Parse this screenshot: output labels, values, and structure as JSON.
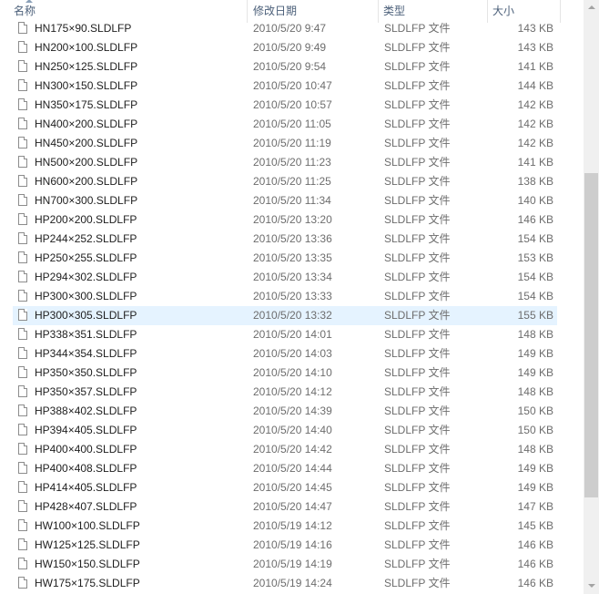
{
  "columns": {
    "name": "名称",
    "date": "修改日期",
    "type": "类型",
    "size": "大小"
  },
  "selected_index": 15,
  "files": [
    {
      "name": "HN175×90.SLDLFP",
      "date": "2010/5/20 9:47",
      "type": "SLDLFP 文件",
      "size": "143 KB"
    },
    {
      "name": "HN200×100.SLDLFP",
      "date": "2010/5/20 9:49",
      "type": "SLDLFP 文件",
      "size": "143 KB"
    },
    {
      "name": "HN250×125.SLDLFP",
      "date": "2010/5/20 9:54",
      "type": "SLDLFP 文件",
      "size": "141 KB"
    },
    {
      "name": "HN300×150.SLDLFP",
      "date": "2010/5/20 10:47",
      "type": "SLDLFP 文件",
      "size": "144 KB"
    },
    {
      "name": "HN350×175.SLDLFP",
      "date": "2010/5/20 10:57",
      "type": "SLDLFP 文件",
      "size": "142 KB"
    },
    {
      "name": "HN400×200.SLDLFP",
      "date": "2010/5/20 11:05",
      "type": "SLDLFP 文件",
      "size": "142 KB"
    },
    {
      "name": "HN450×200.SLDLFP",
      "date": "2010/5/20 11:19",
      "type": "SLDLFP 文件",
      "size": "142 KB"
    },
    {
      "name": "HN500×200.SLDLFP",
      "date": "2010/5/20 11:23",
      "type": "SLDLFP 文件",
      "size": "141 KB"
    },
    {
      "name": "HN600×200.SLDLFP",
      "date": "2010/5/20 11:25",
      "type": "SLDLFP 文件",
      "size": "138 KB"
    },
    {
      "name": "HN700×300.SLDLFP",
      "date": "2010/5/20 11:34",
      "type": "SLDLFP 文件",
      "size": "140 KB"
    },
    {
      "name": "HP200×200.SLDLFP",
      "date": "2010/5/20 13:20",
      "type": "SLDLFP 文件",
      "size": "146 KB"
    },
    {
      "name": "HP244×252.SLDLFP",
      "date": "2010/5/20 13:36",
      "type": "SLDLFP 文件",
      "size": "154 KB"
    },
    {
      "name": "HP250×255.SLDLFP",
      "date": "2010/5/20 13:35",
      "type": "SLDLFP 文件",
      "size": "153 KB"
    },
    {
      "name": "HP294×302.SLDLFP",
      "date": "2010/5/20 13:34",
      "type": "SLDLFP 文件",
      "size": "154 KB"
    },
    {
      "name": "HP300×300.SLDLFP",
      "date": "2010/5/20 13:33",
      "type": "SLDLFP 文件",
      "size": "154 KB"
    },
    {
      "name": "HP300×305.SLDLFP",
      "date": "2010/5/20 13:32",
      "type": "SLDLFP 文件",
      "size": "155 KB"
    },
    {
      "name": "HP338×351.SLDLFP",
      "date": "2010/5/20 14:01",
      "type": "SLDLFP 文件",
      "size": "148 KB"
    },
    {
      "name": "HP344×354.SLDLFP",
      "date": "2010/5/20 14:03",
      "type": "SLDLFP 文件",
      "size": "149 KB"
    },
    {
      "name": "HP350×350.SLDLFP",
      "date": "2010/5/20 14:10",
      "type": "SLDLFP 文件",
      "size": "149 KB"
    },
    {
      "name": "HP350×357.SLDLFP",
      "date": "2010/5/20 14:12",
      "type": "SLDLFP 文件",
      "size": "148 KB"
    },
    {
      "name": "HP388×402.SLDLFP",
      "date": "2010/5/20 14:39",
      "type": "SLDLFP 文件",
      "size": "150 KB"
    },
    {
      "name": "HP394×405.SLDLFP",
      "date": "2010/5/20 14:40",
      "type": "SLDLFP 文件",
      "size": "150 KB"
    },
    {
      "name": "HP400×400.SLDLFP",
      "date": "2010/5/20 14:42",
      "type": "SLDLFP 文件",
      "size": "148 KB"
    },
    {
      "name": "HP400×408.SLDLFP",
      "date": "2010/5/20 14:44",
      "type": "SLDLFP 文件",
      "size": "149 KB"
    },
    {
      "name": "HP414×405.SLDLFP",
      "date": "2010/5/20 14:45",
      "type": "SLDLFP 文件",
      "size": "149 KB"
    },
    {
      "name": "HP428×407.SLDLFP",
      "date": "2010/5/20 14:47",
      "type": "SLDLFP 文件",
      "size": "147 KB"
    },
    {
      "name": "HW100×100.SLDLFP",
      "date": "2010/5/19 14:12",
      "type": "SLDLFP 文件",
      "size": "145 KB"
    },
    {
      "name": "HW125×125.SLDLFP",
      "date": "2010/5/19 14:16",
      "type": "SLDLFP 文件",
      "size": "146 KB"
    },
    {
      "name": "HW150×150.SLDLFP",
      "date": "2010/5/19 14:19",
      "type": "SLDLFP 文件",
      "size": "146 KB"
    },
    {
      "name": "HW175×175.SLDLFP",
      "date": "2010/5/19 14:24",
      "type": "SLDLFP 文件",
      "size": "146 KB"
    }
  ]
}
